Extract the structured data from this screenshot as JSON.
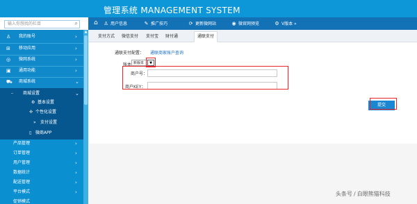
{
  "header": {
    "title": "管理系统 MANAGEMENT SYSTEM",
    "search_placeholder": "输入你想找的栏目"
  },
  "nav": {
    "items": [
      {
        "label": "用户信息",
        "icon": "user-icon"
      },
      {
        "label": "推广技巧",
        "icon": "megaphone-icon"
      },
      {
        "label": "更新微网站",
        "icon": "refresh-icon"
      },
      {
        "label": "微官网预览",
        "icon": "eye-icon"
      },
      {
        "label": "V版本",
        "icon": "version-icon"
      }
    ]
  },
  "sidebar": {
    "items": [
      {
        "label": "我的账号",
        "icon": "user-icon"
      },
      {
        "label": "移动应用",
        "icon": "grid-icon"
      },
      {
        "label": "微网系统",
        "icon": "globe-icon"
      },
      {
        "label": "通用功能",
        "icon": "briefcase-icon"
      },
      {
        "label": "商城系统",
        "icon": "cart-icon"
      }
    ],
    "mall_sub": {
      "label": "商城设置"
    },
    "mall_sub_items": [
      {
        "label": "基本设置",
        "icon": "gear-icon"
      },
      {
        "label": "个性化设置",
        "icon": "sliders-icon"
      },
      {
        "label": "支付设置",
        "icon": "double-chevron-icon"
      },
      {
        "label": "微商APP",
        "icon": "phone-icon"
      }
    ],
    "mall_more": [
      {
        "label": "产品管理"
      },
      {
        "label": "订单管理"
      },
      {
        "label": "用户管理"
      },
      {
        "label": "数据统计"
      },
      {
        "label": "配送管理"
      },
      {
        "label": "平台模式"
      },
      {
        "label": "促销模式"
      }
    ]
  },
  "tabs": [
    {
      "label": "支付方式"
    },
    {
      "label": "微信支付"
    },
    {
      "label": "支付宝"
    },
    {
      "label": "财付通"
    },
    {
      "label": "通联支付",
      "active": true
    }
  ],
  "form": {
    "config_label": "通联支付配置：",
    "config_link": "通联商家账户查询",
    "bank_type_label": "账本类型：",
    "bank_type_value": "新版本",
    "merchant_no_label": "商户号：",
    "merchant_key_label": "商户KEY：",
    "submit_label": "提交"
  },
  "watermark": {
    "text1": "头条号",
    "slash": "/",
    "text2": "白眼熊猫科技"
  }
}
